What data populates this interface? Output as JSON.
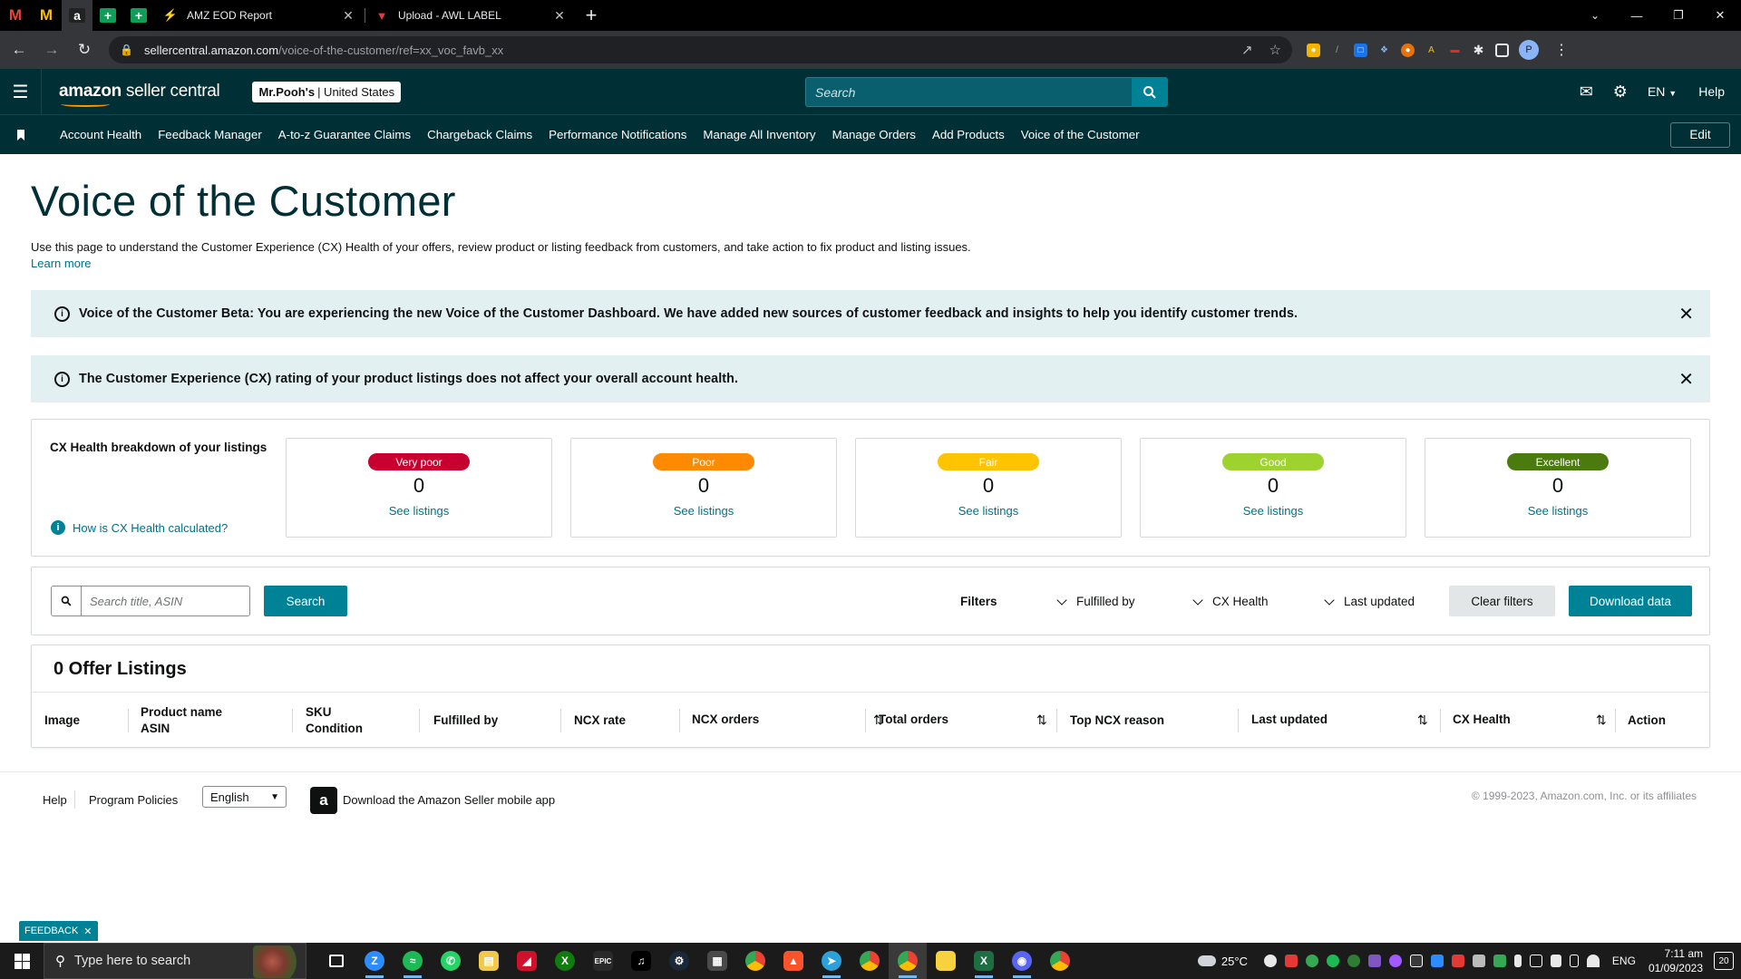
{
  "browser": {
    "tabs": [
      {
        "title": "AMZ EOD Report"
      },
      {
        "title": "Upload - AWL LABEL"
      }
    ],
    "url_host": "sellercentral.amazon.com",
    "url_path": "/voice-of-the-customer/ref=xx_voc_favb_xx",
    "profile_initial": "P"
  },
  "header": {
    "logo_amazon": "amazon",
    "logo_rest": " seller central",
    "store_name": "Mr.Pooh's",
    "store_region": "| United States",
    "search_placeholder": "Search",
    "language": "EN",
    "help": "Help"
  },
  "nav": {
    "items": [
      "Account Health",
      "Feedback Manager",
      "A-to-z Guarantee Claims",
      "Chargeback Claims",
      "Performance Notifications",
      "Manage All Inventory",
      "Manage Orders",
      "Add Products",
      "Voice of the Customer"
    ],
    "edit": "Edit"
  },
  "page": {
    "title": "Voice of the Customer",
    "intro": "Use this page to understand the Customer Experience (CX) Health of your offers, review product or listing feedback from customers, and take action to fix product and listing issues.",
    "learn_more": "Learn more",
    "alerts": [
      "Voice of the Customer Beta: You are experiencing the new Voice of the Customer Dashboard. We have added new sources of customer feedback and insights to help you identify customer trends.",
      "The Customer Experience (CX) rating of your product listings does not affect your overall account health."
    ]
  },
  "cx_health": {
    "title": "CX Health breakdown of your listings",
    "how_link": "How is CX Health calculated?",
    "cards": [
      {
        "label": "Very poor",
        "count": "0",
        "link": "See listings",
        "color": "#c7002f"
      },
      {
        "label": "Poor",
        "count": "0",
        "link": "See listings",
        "color": "#ff8a00"
      },
      {
        "label": "Fair",
        "count": "0",
        "link": "See listings",
        "color": "#ffc400"
      },
      {
        "label": "Good",
        "count": "0",
        "link": "See listings",
        "color": "#9ed22e"
      },
      {
        "label": "Excellent",
        "count": "0",
        "link": "See listings",
        "color": "#4b7a0e"
      }
    ]
  },
  "filters": {
    "search_placeholder": "Search title, ASIN",
    "search_button": "Search",
    "label": "Filters",
    "dropdowns": [
      "Fulfilled by",
      "CX Health",
      "Last updated"
    ],
    "clear": "Clear filters",
    "download": "Download data"
  },
  "table": {
    "title": "0 Offer Listings",
    "columns": [
      {
        "line1": "Image",
        "line2": ""
      },
      {
        "line1": "Product name",
        "line2": "ASIN"
      },
      {
        "line1": "SKU",
        "line2": "Condition"
      },
      {
        "line1": "Fulfilled by",
        "line2": ""
      },
      {
        "line1": "NCX rate",
        "line2": ""
      },
      {
        "line1": "NCX orders",
        "line2": ""
      },
      {
        "line1": "Total orders",
        "line2": ""
      },
      {
        "line1": "Top NCX reason",
        "line2": ""
      },
      {
        "line1": "Last updated",
        "line2": ""
      },
      {
        "line1": "CX Health",
        "line2": ""
      },
      {
        "line1": "Action",
        "line2": ""
      }
    ]
  },
  "footer": {
    "help": "Help",
    "program_policies": "Program Policies",
    "language": "English",
    "app_text": "Download the Amazon Seller mobile app",
    "copyright": "© 1999-2023, Amazon.com, Inc. or its affiliates",
    "feedback": "FEEDBACK"
  },
  "taskbar": {
    "search_placeholder": "Type here to search",
    "temperature": "25°C",
    "language": "ENG",
    "time": "7:11 am",
    "date": "01/09/2023",
    "notifications": "20"
  },
  "colors": {
    "header_bg": "#002f36",
    "teal_button": "#008296",
    "link": "#007185",
    "alert_bg": "#e3f0f2"
  }
}
